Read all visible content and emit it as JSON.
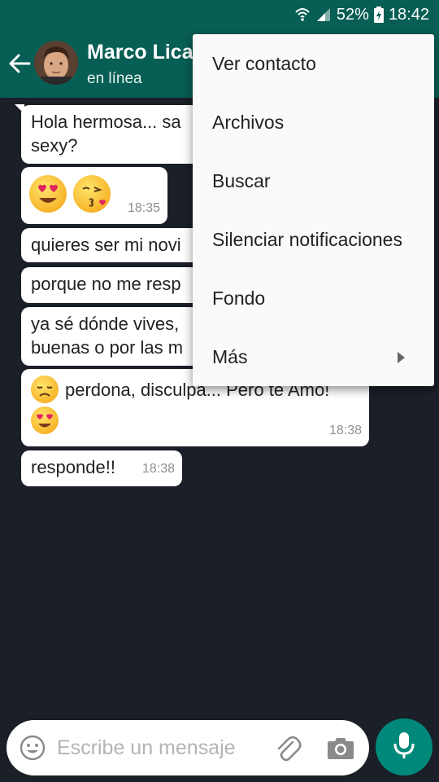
{
  "status_bar": {
    "battery": "52%",
    "time": "18:42",
    "icons": [
      "wifi-icon",
      "signal-icon",
      "battery-icon"
    ]
  },
  "header": {
    "contact_name": "Marco Lica",
    "contact_status": "en línea",
    "icons": [
      "back-arrow-icon",
      "avatar"
    ]
  },
  "messages": [
    {
      "text": "Hola hermosa... sa",
      "text2": "sexy?",
      "time": ""
    },
    {
      "emojis": [
        "heart-eyes-emoji",
        "kissing-heart-emoji"
      ],
      "time": "18:35"
    },
    {
      "text": "quieres ser mi novi",
      "time": ""
    },
    {
      "text": "porque no me resp",
      "time": ""
    },
    {
      "text": "ya sé dónde vives,",
      "text2": "buenas o por las m",
      "time": ""
    },
    {
      "text": "perdona, disculpa... Pero te Amo!",
      "emojis": [
        "disappointed-face-emoji",
        "heart-eyes-emoji"
      ],
      "time": "18:38"
    },
    {
      "text": "responde!!",
      "time": "18:38"
    }
  ],
  "menu": {
    "items": [
      {
        "label": "Ver contacto"
      },
      {
        "label": "Archivos"
      },
      {
        "label": "Buscar"
      },
      {
        "label": "Silenciar notificaciones"
      },
      {
        "label": "Fondo"
      },
      {
        "label": "Más",
        "has_submenu": true
      }
    ]
  },
  "input": {
    "placeholder": "Escribe un mensaje",
    "value": "",
    "icons": [
      "emoji-icon",
      "paperclip-icon",
      "camera-icon",
      "mic-icon"
    ]
  },
  "colors": {
    "header": "#075e54",
    "background": "#1b1f27",
    "accent": "#00897b",
    "bubble": "#ffffff"
  }
}
